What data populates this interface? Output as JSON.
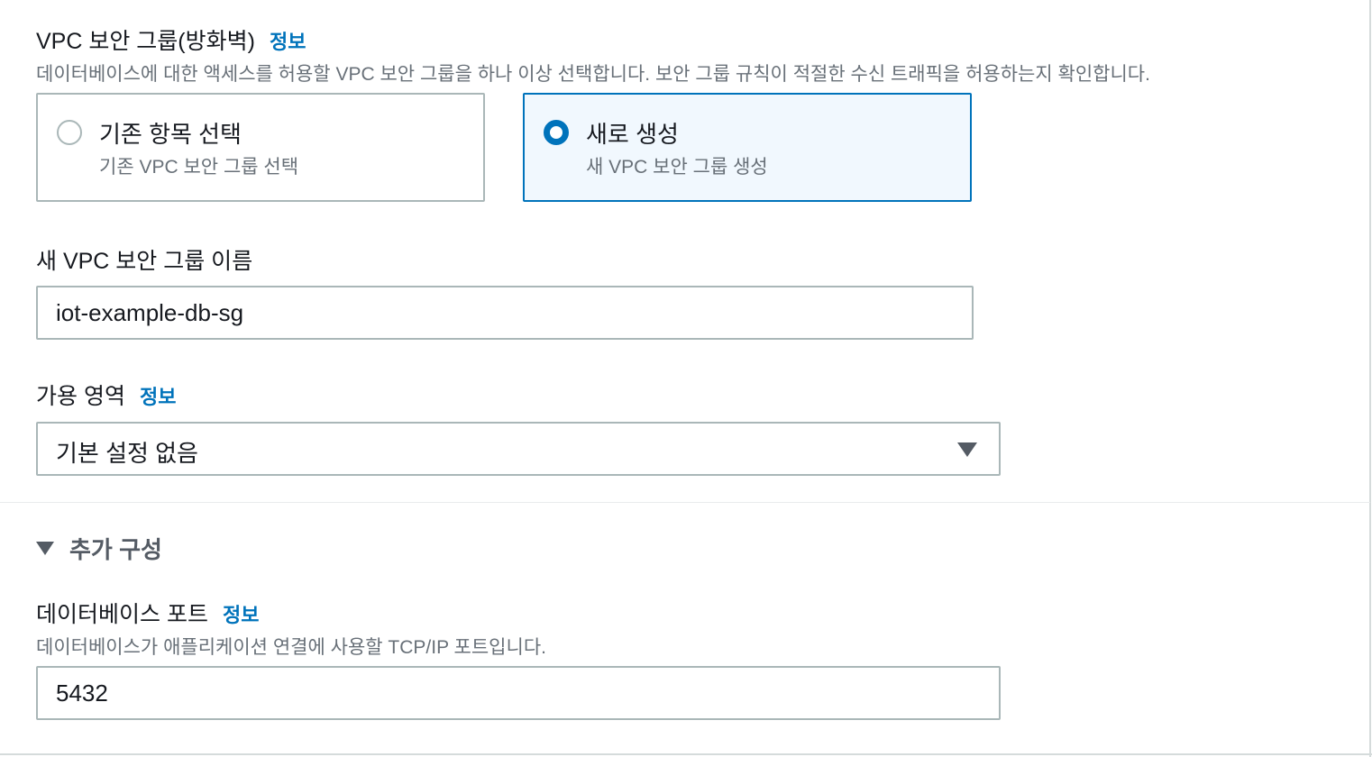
{
  "vpc_security_group": {
    "label": "VPC 보안 그룹(방화벽)",
    "info": "정보",
    "description": "데이터베이스에 대한 액세스를 허용할 VPC 보안 그룹을 하나 이상 선택합니다. 보안 그룹 규칙이 적절한 수신 트래픽을 허용하는지 확인합니다.",
    "options": [
      {
        "title": "기존 항목 선택",
        "subtitle": "기존 VPC 보안 그룹 선택",
        "selected": false
      },
      {
        "title": "새로 생성",
        "subtitle": "새 VPC 보안 그룹 생성",
        "selected": true
      }
    ]
  },
  "new_sg_name": {
    "label": "새 VPC 보안 그룹 이름",
    "value": "iot-example-db-sg"
  },
  "availability_zone": {
    "label": "가용 영역",
    "info": "정보",
    "selected": "기본 설정 없음",
    "caret_icon": "caret-down-icon"
  },
  "additional_config": {
    "label": "추가 구성",
    "expanded": true,
    "icon": "caret-down-icon"
  },
  "database_port": {
    "label": "데이터베이스 포트",
    "info": "정보",
    "description": "데이터베이스가 애플리케이션 연결에 사용할 TCP/IP 포트입니다.",
    "value": "5432"
  },
  "colors": {
    "accent": "#0073bb",
    "selected_tile_bg": "#f1f8fe",
    "border": "#aab7b8",
    "secondary_text": "#687078"
  }
}
